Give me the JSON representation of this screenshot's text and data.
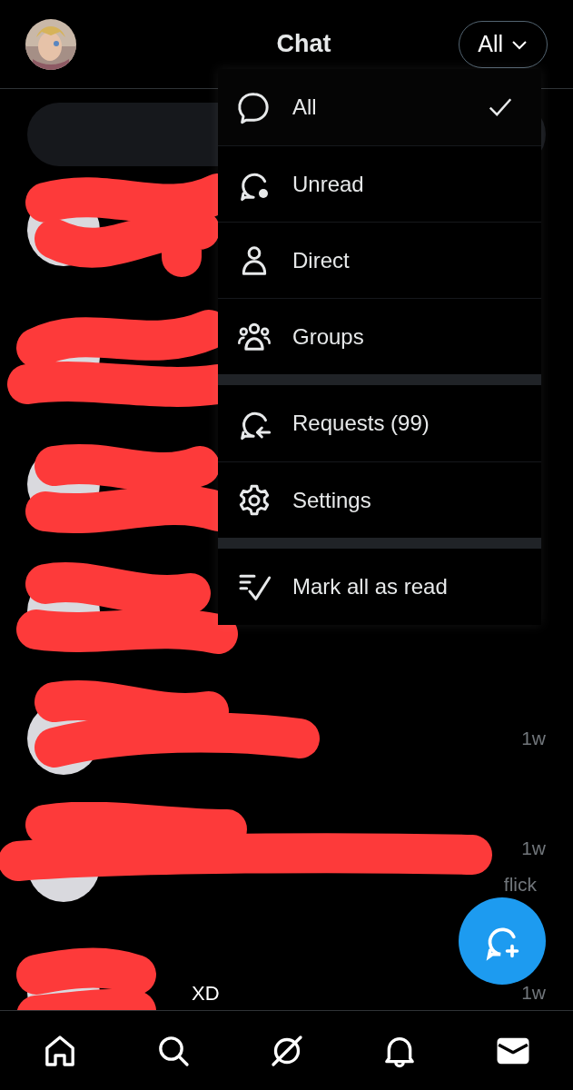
{
  "header": {
    "title": "Chat",
    "filter_button": "All"
  },
  "menu": {
    "sections": [
      [
        {
          "kind": "all",
          "label": "All",
          "selected": true
        },
        {
          "kind": "unread",
          "label": "Unread",
          "selected": false
        },
        {
          "kind": "direct",
          "label": "Direct",
          "selected": false
        },
        {
          "kind": "groups",
          "label": "Groups",
          "selected": false
        }
      ],
      [
        {
          "kind": "requests",
          "label": "Requests (99)",
          "selected": false
        },
        {
          "kind": "settings",
          "label": "Settings",
          "selected": false
        }
      ],
      [
        {
          "kind": "mark_read",
          "label": "Mark all as read",
          "selected": false
        }
      ]
    ]
  },
  "conversations": [
    {
      "kind": "redacted"
    },
    {
      "kind": "redacted"
    },
    {
      "kind": "redacted"
    },
    {
      "kind": "redacted"
    },
    {
      "kind": "redacted",
      "time": "1w"
    },
    {
      "kind": "redacted",
      "time": "1w",
      "preview": "flick"
    },
    {
      "kind": "redacted",
      "time": "1w",
      "name": "XD"
    }
  ],
  "nav": [
    {
      "kind": "home",
      "selected": false
    },
    {
      "kind": "search",
      "selected": false
    },
    {
      "kind": "grok",
      "selected": false
    },
    {
      "kind": "notifications",
      "selected": false
    },
    {
      "kind": "messages",
      "selected": true
    }
  ]
}
